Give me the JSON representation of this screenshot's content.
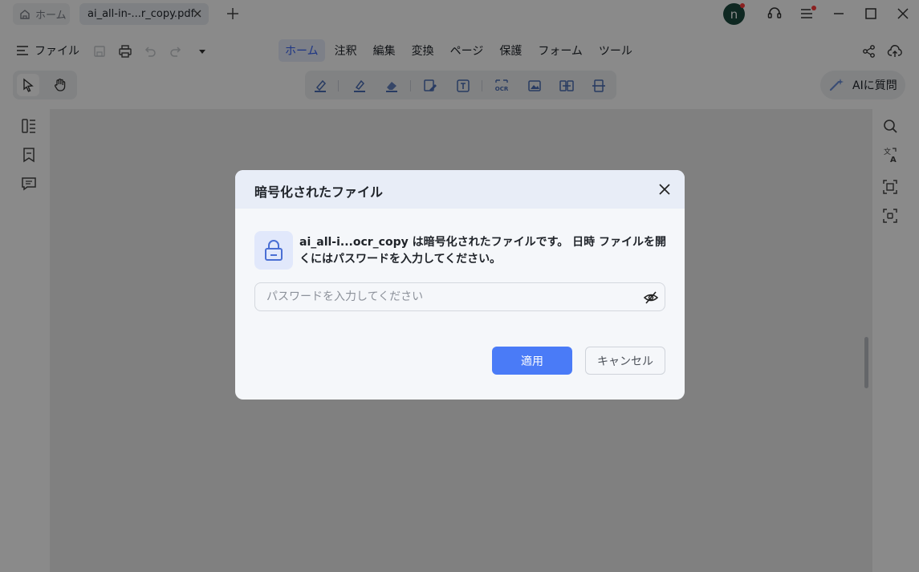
{
  "titlebar": {
    "home_tab": "ホーム",
    "doc_tab": "ai_all-in-...r_copy.pdf",
    "avatar_initial": "n"
  },
  "menubar": {
    "file_label": "ファイル",
    "tabs": [
      "ホーム",
      "注釈",
      "編集",
      "変換",
      "ページ",
      "保護",
      "フォーム",
      "ツール"
    ],
    "active_tab": "ホーム"
  },
  "toolbar": {
    "ai_label": "AIに質問"
  },
  "dialog": {
    "title": "暗号化されたファイル",
    "message": "ai_all-i...ocr_copy は暗号化されたファイルです。 日時 ファイルを開くにはパスワードを入力してください。",
    "password_placeholder": "パスワードを入力してください",
    "password_value": "",
    "apply_label": "適用",
    "cancel_label": "キャンセル"
  },
  "colors": {
    "accent": "#4a7bf7",
    "active_tab_text": "#3763f4",
    "avatar_bg": "#1d4b3f",
    "notification_dot": "#ff3b3b"
  }
}
